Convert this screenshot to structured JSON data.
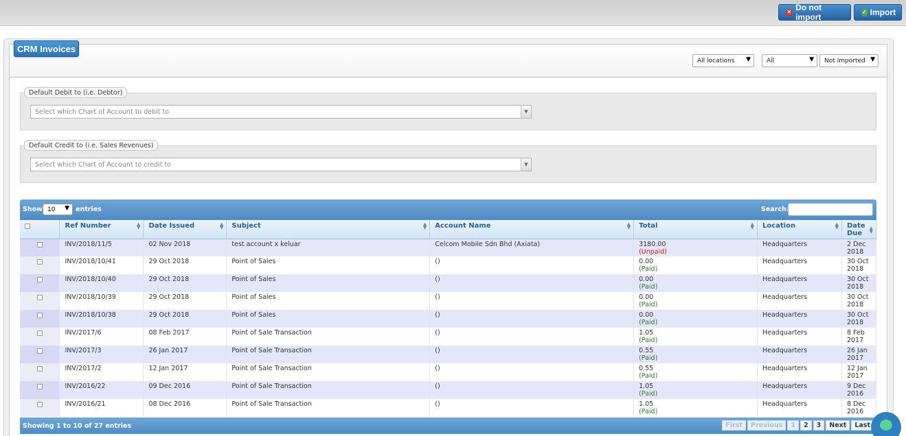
{
  "toolbar": {
    "do_not_import_label": "Do not import",
    "import_label": "Import",
    "do_not_import_icon": "x-circle-icon",
    "import_icon": "check-circle-icon"
  },
  "panel": {
    "title": "CRM Invoices",
    "filters": {
      "location": "All locations",
      "status": "All",
      "import_state": "Not Imported"
    }
  },
  "debit": {
    "legend": "Default Debit to (i.e. Debtor)",
    "placeholder": "Select which Chart of Account to debit to"
  },
  "credit": {
    "legend": "Default Credit to (i.e. Sales Revenues)",
    "placeholder": "Select which Chart of Account to credit to"
  },
  "table": {
    "show_label": "Show",
    "entries_value": "10",
    "entries_label": "entries",
    "search_label": "Search:",
    "columns": {
      "ref": "Ref Number",
      "date_issued": "Date Issued",
      "subject": "Subject",
      "account": "Account Name",
      "total": "Total",
      "location": "Location",
      "date_due": "Date Due"
    },
    "rows": [
      {
        "ref": "INV/2018/11/5",
        "date_issued": "02 Nov 2018",
        "subject": "test account x keluar",
        "account": "Celcom Mobile Sdn Bhd (Axiata)",
        "total": "3180.00",
        "status": "(Unpaid)",
        "location": "Headquarters",
        "due_1": "2 Dec",
        "due_2": "2018"
      },
      {
        "ref": "INV/2018/10/41",
        "date_issued": "29 Oct 2018",
        "subject": "Point of Sales",
        "account": "()",
        "total": "0.00",
        "status": "(Paid)",
        "location": "Headquarters",
        "due_1": "30 Oct",
        "due_2": "2018"
      },
      {
        "ref": "INV/2018/10/40",
        "date_issued": "29 Oct 2018",
        "subject": "Point of Sales",
        "account": "()",
        "total": "0.00",
        "status": "(Paid)",
        "location": "Headquarters",
        "due_1": "30 Oct",
        "due_2": "2018"
      },
      {
        "ref": "INV/2018/10/39",
        "date_issued": "29 Oct 2018",
        "subject": "Point of Sales",
        "account": "()",
        "total": "0.00",
        "status": "(Paid)",
        "location": "Headquarters",
        "due_1": "30 Oct",
        "due_2": "2018"
      },
      {
        "ref": "INV/2018/10/38",
        "date_issued": "29 Oct 2018",
        "subject": "Point of Sales",
        "account": "()",
        "total": "0.00",
        "status": "(Paid)",
        "location": "Headquarters",
        "due_1": "30 Oct",
        "due_2": "2018"
      },
      {
        "ref": "INV/2017/6",
        "date_issued": "08 Feb 2017",
        "subject": "Point of Sale Transaction",
        "account": "()",
        "total": "1.05",
        "status": "(Paid)",
        "location": "Headquarters",
        "due_1": "8 Feb",
        "due_2": "2017"
      },
      {
        "ref": "INV/2017/3",
        "date_issued": "26 Jan 2017",
        "subject": "Point of Sale Transaction",
        "account": "()",
        "total": "0.55",
        "status": "(Paid)",
        "location": "Headquarters",
        "due_1": "26 Jan",
        "due_2": "2017"
      },
      {
        "ref": "INV/2017/2",
        "date_issued": "12 Jan 2017",
        "subject": "Point of Sale Transaction",
        "account": "()",
        "total": "0.55",
        "status": "(Paid)",
        "location": "Headquarters",
        "due_1": "12 Jan",
        "due_2": "2017"
      },
      {
        "ref": "INV/2016/22",
        "date_issued": "09 Dec 2016",
        "subject": "Point of Sale Transaction",
        "account": "()",
        "total": "1.05",
        "status": "(Paid)",
        "location": "Headquarters",
        "due_1": "9 Dec",
        "due_2": "2016"
      },
      {
        "ref": "INV/2016/21",
        "date_issued": "08 Dec 2016",
        "subject": "Point of Sale Transaction",
        "account": "()",
        "total": "1.05",
        "status": "(Paid)",
        "location": "Headquarters",
        "due_1": "8 Dec",
        "due_2": "2016"
      }
    ],
    "info": "Showing 1 to 10 of 27 entries",
    "pager": {
      "first": "First",
      "previous": "Previous",
      "pages": [
        "1",
        "2",
        "3"
      ],
      "next": "Next",
      "last": "Last"
    }
  },
  "chat": {
    "icon": "chat-bubble-icon"
  }
}
